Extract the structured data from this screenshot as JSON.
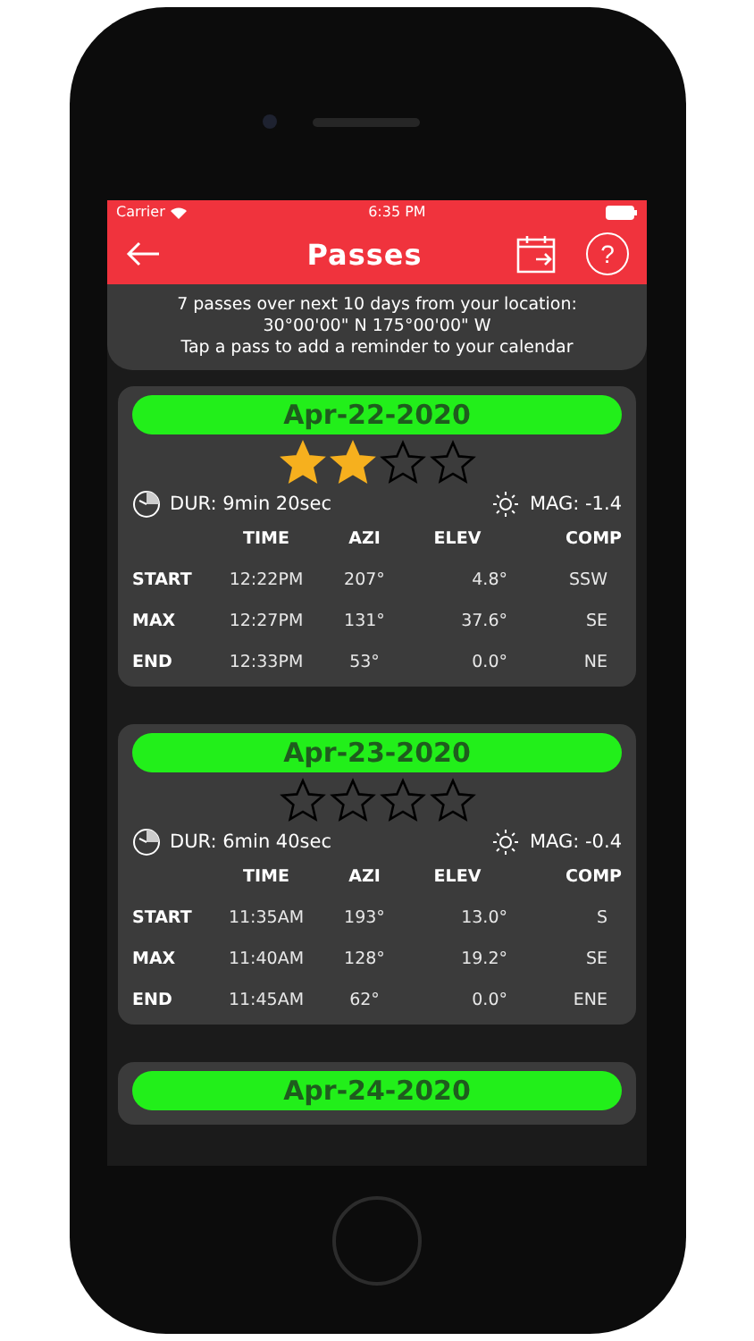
{
  "status_bar": {
    "carrier": "Carrier",
    "time": "6:35 PM"
  },
  "nav": {
    "title": "Passes",
    "help": "?"
  },
  "info": [
    "7 passes over next 10 days from your location:",
    "30°00'00\" N  175°00'00\" W",
    "Tap a pass to add a reminder to your calendar"
  ],
  "passes": [
    {
      "date": "Apr-22-2020",
      "stars": 2,
      "duration": "DUR: 9min 20sec",
      "magnitude": "MAG: -1.4",
      "columns": [
        "TIME",
        "AZI",
        "ELEV",
        "COMP"
      ],
      "rows": [
        {
          "label": "START",
          "time": "12:22PM",
          "azi": "207°",
          "elev": "4.8°",
          "comp": "SSW"
        },
        {
          "label": "MAX",
          "time": "12:27PM",
          "azi": "131°",
          "elev": "37.6°",
          "comp": "SE"
        },
        {
          "label": "END",
          "time": "12:33PM",
          "azi": "53°",
          "elev": "0.0°",
          "comp": "NE"
        }
      ]
    },
    {
      "date": "Apr-23-2020",
      "stars": 0,
      "duration": "DUR: 6min 40sec",
      "magnitude": "MAG: -0.4",
      "columns": [
        "TIME",
        "AZI",
        "ELEV",
        "COMP"
      ],
      "rows": [
        {
          "label": "START",
          "time": "11:35AM",
          "azi": "193°",
          "elev": "13.0°",
          "comp": "S"
        },
        {
          "label": "MAX",
          "time": "11:40AM",
          "azi": "128°",
          "elev": "19.2°",
          "comp": "SE"
        },
        {
          "label": "END",
          "time": "11:45AM",
          "azi": "62°",
          "elev": "0.0°",
          "comp": "ENE"
        }
      ]
    },
    {
      "date": "Apr-24-2020"
    }
  ]
}
